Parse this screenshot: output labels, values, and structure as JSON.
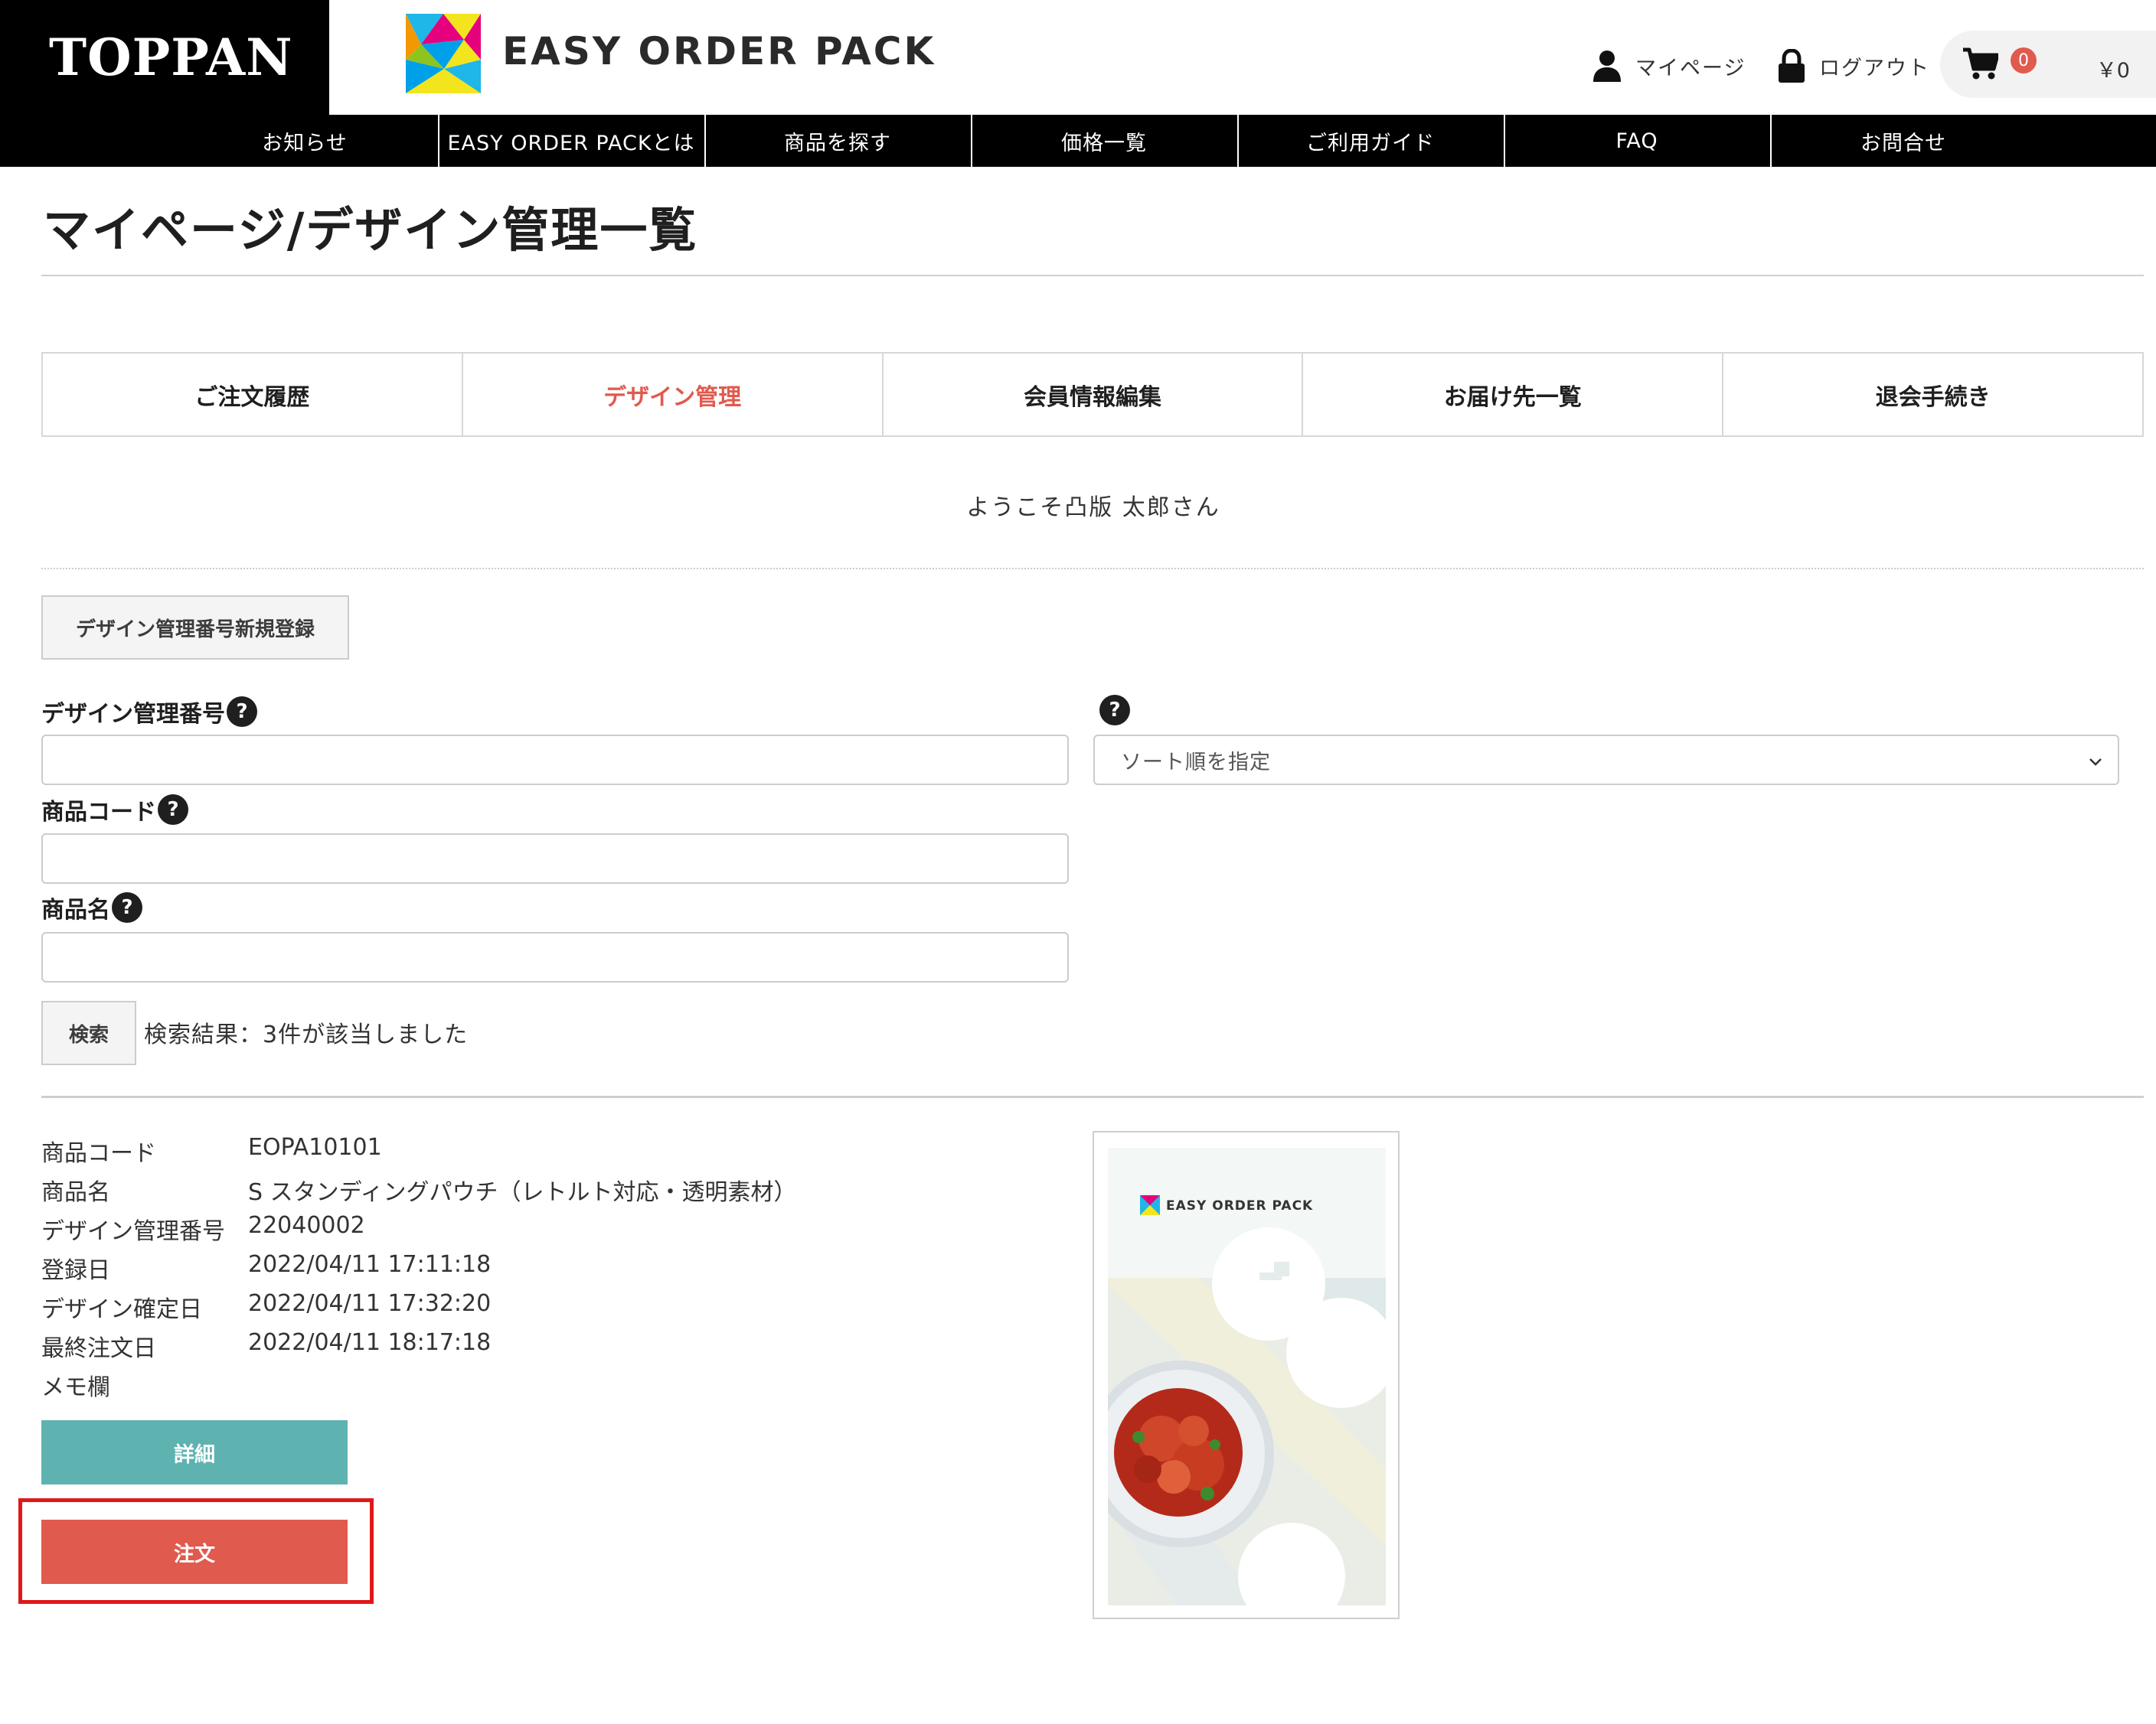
{
  "header": {
    "brand": "TOPPAN",
    "site_name": "EASY ORDER PACK",
    "mypage_label": "マイページ",
    "logout_label": "ログアウト",
    "cart_count": "0",
    "cart_total": "￥0",
    "logo_icon": "colorful-triangle-logo-icon"
  },
  "nav": {
    "items": [
      "お知らせ",
      "EASY ORDER PACKとは",
      "商品を探す",
      "価格一覧",
      "ご利用ガイド",
      "FAQ",
      "お問合せ"
    ]
  },
  "page": {
    "title": "マイページ/デザイン管理一覧",
    "tabs": [
      "ご注文履歴",
      "デザイン管理",
      "会員情報編集",
      "お届け先一覧",
      "退会手続き"
    ],
    "active_tab": "デザイン管理",
    "welcome": "ようこそ凸版 太郎さん"
  },
  "search": {
    "register_button": "デザイン管理番号新規登録",
    "design_number_label": "デザイン管理番号",
    "design_number_value": "",
    "product_code_label": "商品コード",
    "product_code_value": "",
    "product_name_label": "商品名",
    "product_name_value": "",
    "help_glyph": "?",
    "sort_placeholder": "ソート順を指定",
    "search_button": "検索",
    "result_text": "検索結果：3件が該当しました"
  },
  "result": {
    "fields": [
      {
        "label": "商品コード",
        "value": "EOPA10101"
      },
      {
        "label": "商品名",
        "value": "S スタンディングパウチ（レトルト対応・透明素材）"
      },
      {
        "label": "デザイン管理番号",
        "value": "22040002"
      },
      {
        "label": "登録日",
        "value": "2022/04/11 17:11:18"
      },
      {
        "label": "デザイン確定日",
        "value": "2022/04/11 17:32:20"
      },
      {
        "label": "最終注文日",
        "value": "2022/04/11 18:17:18"
      },
      {
        "label": "メモ欄",
        "value": ""
      }
    ],
    "detail_button": "詳細",
    "order_button": "注文",
    "thumbnail_brand": "EASY ORDER PACK"
  },
  "colors": {
    "accent_red": "#e05a4e",
    "teal": "#5eb3b1",
    "highlight": "#e01818",
    "nav_bg": "#000000"
  }
}
